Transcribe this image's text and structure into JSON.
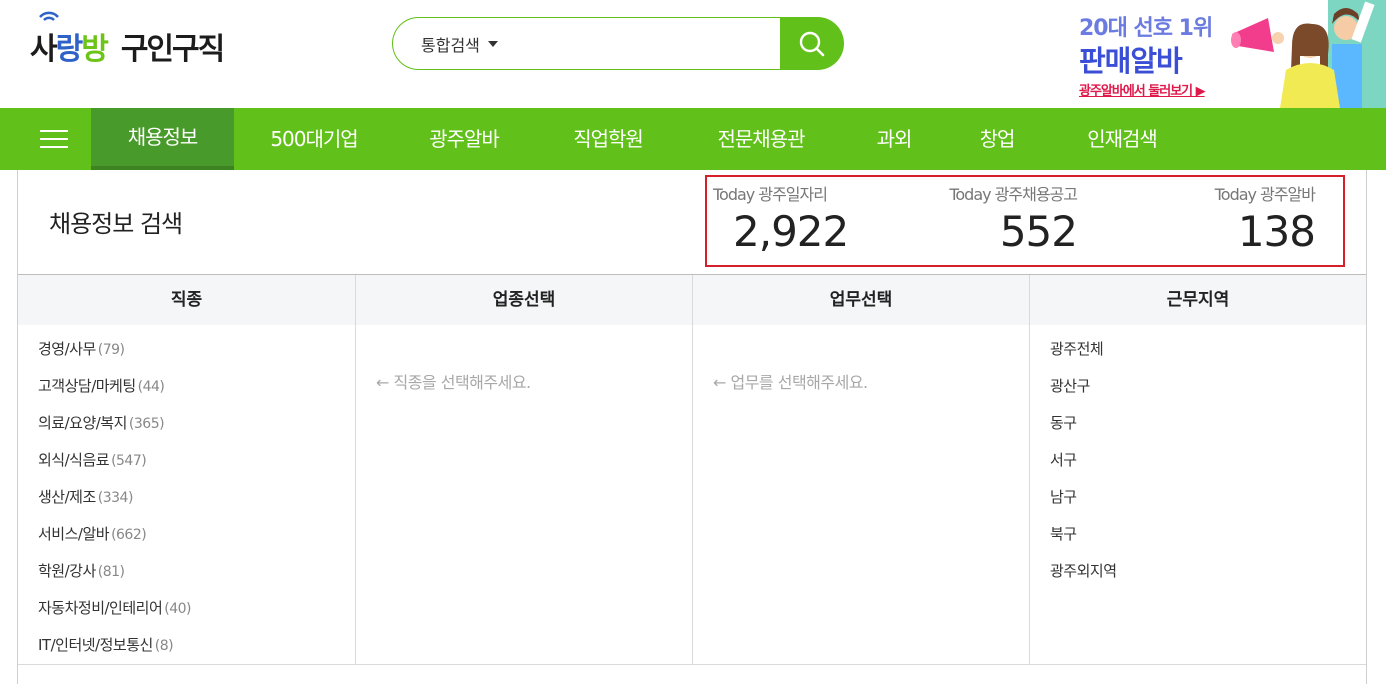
{
  "header": {
    "logo_brand": [
      "사",
      "랑",
      "방"
    ],
    "logo_sub": "구인구직",
    "search": {
      "category": "통합검색",
      "query": ""
    },
    "banner": {
      "line1": "20대 선호 1위",
      "line2": "판매알바",
      "line3": "광주알바에서 둘러보기 ▶"
    }
  },
  "nav": {
    "items": [
      "채용정보",
      "500대기업",
      "광주알바",
      "직업학원",
      "전문채용관",
      "과외",
      "창업",
      "인재검색"
    ],
    "active_index": 0
  },
  "page": {
    "title": "채용정보 검색",
    "stats": [
      {
        "label": "Today 광주일자리",
        "value": "2,922"
      },
      {
        "label": "Today 광주채용공고",
        "value": "552"
      },
      {
        "label": "Today 광주알바",
        "value": "138"
      }
    ]
  },
  "columns": {
    "job": {
      "header": "직종",
      "items": [
        {
          "label": "경영/사무",
          "count": "(79)"
        },
        {
          "label": "고객상담/마케팅",
          "count": "(44)"
        },
        {
          "label": "의료/요양/복지",
          "count": "(365)"
        },
        {
          "label": "외식/식음료",
          "count": "(547)"
        },
        {
          "label": "생산/제조",
          "count": "(334)"
        },
        {
          "label": "서비스/알바",
          "count": "(662)"
        },
        {
          "label": "학원/강사",
          "count": "(81)"
        },
        {
          "label": "자동차정비/인테리어",
          "count": "(40)"
        },
        {
          "label": "IT/인터넷/정보통신",
          "count": "(8)"
        }
      ]
    },
    "industry": {
      "header": "업종선택",
      "hint": "← 직종을 선택해주세요."
    },
    "duty": {
      "header": "업무선택",
      "hint": "← 업무를 선택해주세요."
    },
    "region": {
      "header": "근무지역",
      "items": [
        "광주전체",
        "광산구",
        "동구",
        "서구",
        "남구",
        "북구",
        "광주외지역"
      ]
    }
  },
  "colors": {
    "brand_green": "#61c01a",
    "nav_active": "#489a2b",
    "highlight_border": "#d4202a"
  }
}
